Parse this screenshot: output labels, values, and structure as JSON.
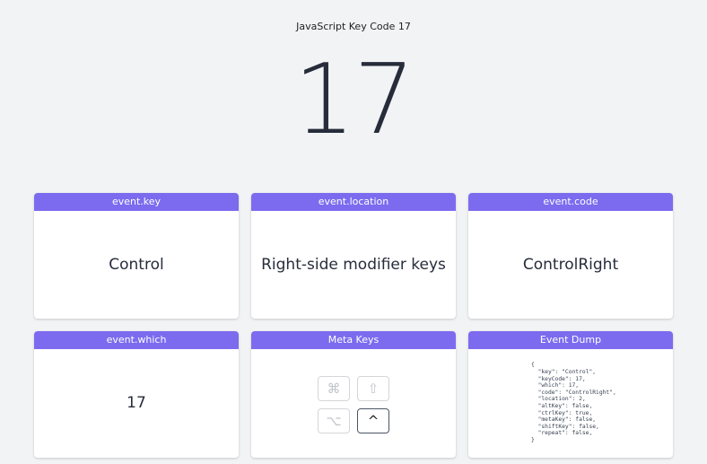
{
  "page": {
    "title": "JavaScript Key Code 17",
    "key_code": "17"
  },
  "cards": {
    "event_key": {
      "header": "event.key",
      "value": "Control"
    },
    "event_location": {
      "header": "event.location",
      "value": "Right-side modifier keys"
    },
    "event_code": {
      "header": "event.code",
      "value": "ControlRight"
    },
    "event_which": {
      "header": "event.which",
      "value": "17"
    },
    "meta_keys": {
      "header": "Meta Keys",
      "keys": [
        {
          "glyph": "⌘",
          "icon": "command-key-icon",
          "active": false
        },
        {
          "glyph": "⇧",
          "icon": "shift-key-icon",
          "active": false
        },
        {
          "glyph": "⌥",
          "icon": "option-key-icon",
          "active": false
        },
        {
          "glyph": "^",
          "icon": "control-key-icon",
          "active": true
        }
      ]
    },
    "event_dump": {
      "header": "Event Dump",
      "text": "{\n  \"key\": \"Control\",\n  \"keyCode\": 17,\n  \"which\": 17,\n  \"code\": \"ControlRight\",\n  \"location\": 2,\n  \"altKey\": false,\n  \"ctrlKey\": true,\n  \"metaKey\": false,\n  \"shiftKey\": false,\n  \"repeat\": false,\n}"
    }
  },
  "colors": {
    "accent": "#7c6bef",
    "background": "#f2f3f5",
    "text": "#262c3a"
  }
}
